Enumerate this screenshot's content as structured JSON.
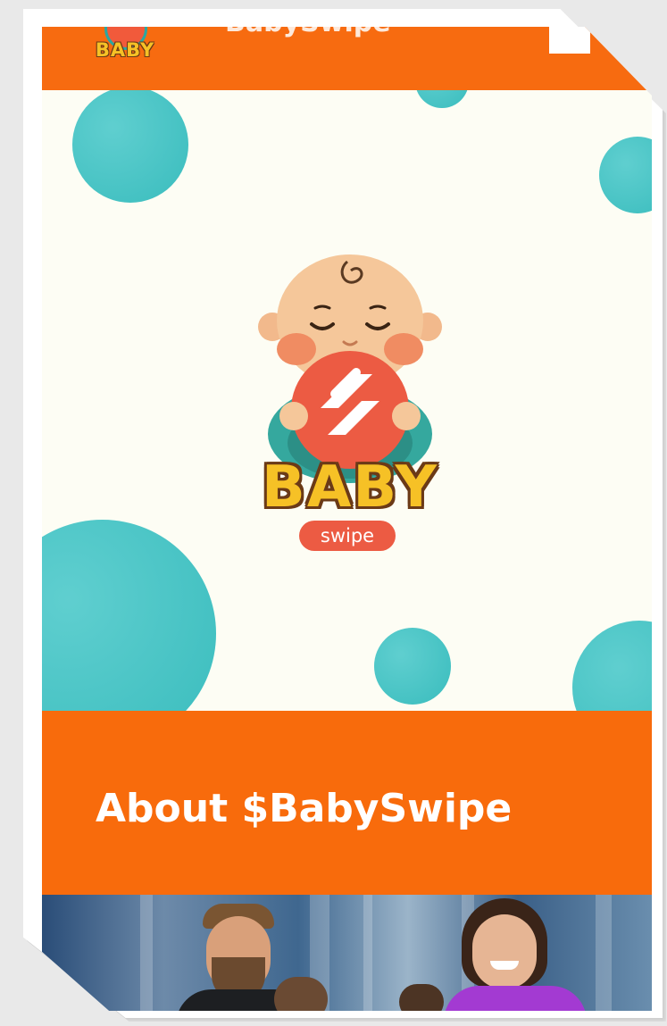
{
  "header": {
    "logo_text": "BABY",
    "title": "BabySwipe"
  },
  "hero": {
    "logo_wordmark": "BABY",
    "logo_pill": "swipe"
  },
  "about": {
    "title": "About $BabySwipe"
  },
  "colors": {
    "accent_orange": "#f76b10",
    "teal_dots": "#3cc4c5",
    "background": "#fdfdf4",
    "logo_yellow": "#f6c126",
    "pill_red": "#ec5b43"
  },
  "icons": [
    "baby-swipe-mascot-icon",
    "swipe-logo-icon"
  ]
}
